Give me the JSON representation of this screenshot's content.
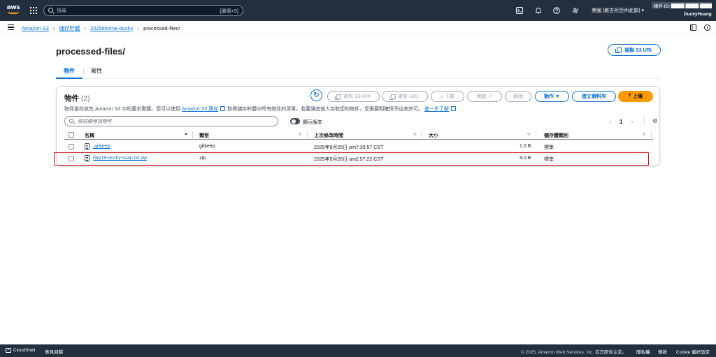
{
  "topnav": {
    "logo_text": "aws",
    "search_placeholder": "搜尋",
    "search_shortcut": "[選項+S]",
    "region": "美國 (維吉尼亞州北部) ▾",
    "account_top": "帳戶 ID: ████-████-████",
    "account_name": "DuckyHuang",
    "icons": [
      "grid-icon",
      "search-icon",
      "cloudshell-icon",
      "bell-icon",
      "help-icon",
      "gear-icon"
    ]
  },
  "breadcrumb": {
    "items": [
      "Amazon S3",
      "儲存貯體",
      "2025ithome-ducky"
    ],
    "current": "processed-files/",
    "icons": [
      "panel-icon",
      "info-icon"
    ]
  },
  "page": {
    "title": "processed-files/",
    "copy_uri_button": "複製 S3 URI"
  },
  "tabs": [
    {
      "label": "物件",
      "active": true
    },
    {
      "label": "屬性",
      "active": false
    }
  ],
  "objects_panel": {
    "title": "物件",
    "count": "(2)",
    "description_pre": "物件是存放在 Amazon S3 中的基本實體。您可以使用",
    "description_link": "Amazon S3 庫存",
    "description_mid": "取得儲存貯體中所有物件的清單。若要讓其他人存取您的物件，您需要明確授予這些許可。",
    "description_link2": "進一步了解",
    "buttons": {
      "copy_s3_uri": "複製 S3 URI",
      "copy_url": "複製 URL",
      "download": "下載",
      "open": "開啟",
      "delete": "刪除",
      "actions": "動作 ▼",
      "create_folder": "建立資料夾",
      "upload": "上傳"
    },
    "filter_placeholder": "依前綴尋找物件",
    "show_versions_label": "顯示版本",
    "pager": {
      "prev": "‹",
      "page": "1",
      "next": "›"
    },
    "columns": [
      "名稱",
      "類型",
      "上次修改時間",
      "大小",
      "儲存體類別"
    ],
    "rows": [
      {
        "name": ".gitkeep",
        "type": "gitkeep",
        "modified": "2025年9月25日 pm7:35:57 CST",
        "size": "1.0 B",
        "storage_class": "標準"
      },
      {
        "name": "day19-ducky-scan.txt.zip",
        "type": "zip",
        "modified": "2025年9月26日 am2:57:22 CST",
        "size": "9.0 B",
        "storage_class": "標準"
      }
    ]
  },
  "footer": {
    "cloudshell": "CloudShell",
    "feedback": "意見回饋",
    "copyright": "© 2025, Amazon Web Services, Inc. 或其關係企業。",
    "privacy": "隱私權",
    "terms": "條款",
    "cookie": "Cookie 偏好設定"
  },
  "colors": {
    "nav_bg": "#232f3e",
    "link_blue": "#0972d3",
    "primary_orange": "#ff9900",
    "highlight_red": "#d91515"
  }
}
